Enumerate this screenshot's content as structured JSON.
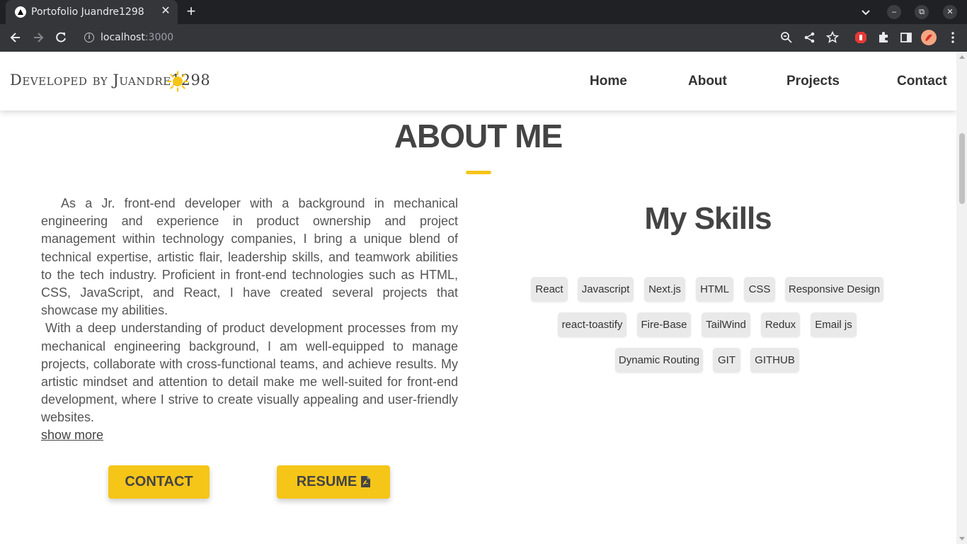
{
  "browser": {
    "tab_title": "Portofolio Juandre1298",
    "tab_close": "✕",
    "new_tab": "+",
    "url_host": "localhost",
    "url_port": ":3000",
    "window_controls": {
      "minimize": "–",
      "restore": "⧉",
      "close": "✕"
    }
  },
  "navbar": {
    "brand": "Developed by Juandre1298",
    "theme_icon": "sun-icon",
    "links": [
      "Home",
      "About",
      "Projects",
      "Contact"
    ]
  },
  "about": {
    "title": "ABOUT ME",
    "paragraph_1": "As a Jr. front-end developer with a background in mechanical engineering and experience in product ownership and project management within technology companies, I bring a unique blend of technical expertise, artistic flair, leadership skills, and teamwork abilities to the tech industry. Proficient in front-end technologies such as HTML, CSS, JavaScript, and React, I have created several projects that showcase my abilities.",
    "paragraph_2": "With a deep understanding of product development processes from my mechanical engineering background, I am well-equipped to manage projects, collaborate with cross-functional teams, and achieve results. My artistic mindset and attention to detail make me well-suited for front-end development, where I strive to create visually appealing and user-friendly websites.",
    "show_more": "show more",
    "contact_button": "CONTACT",
    "resume_button": "RESUME"
  },
  "skills": {
    "title": "My Skills",
    "items": [
      "React",
      "Javascript",
      "Next.js",
      "HTML",
      "CSS",
      "Responsive Design",
      "react-toastify",
      "Fire-Base",
      "TailWind",
      "Redux",
      "Email js",
      "Dynamic Routing",
      "GIT",
      "GITHUB"
    ]
  },
  "colors": {
    "accent": "#f5c518",
    "chrome_dark": "#202124",
    "chrome_toolbar": "#35363a",
    "text": "#444444",
    "chip_bg": "#e9e9e9"
  }
}
